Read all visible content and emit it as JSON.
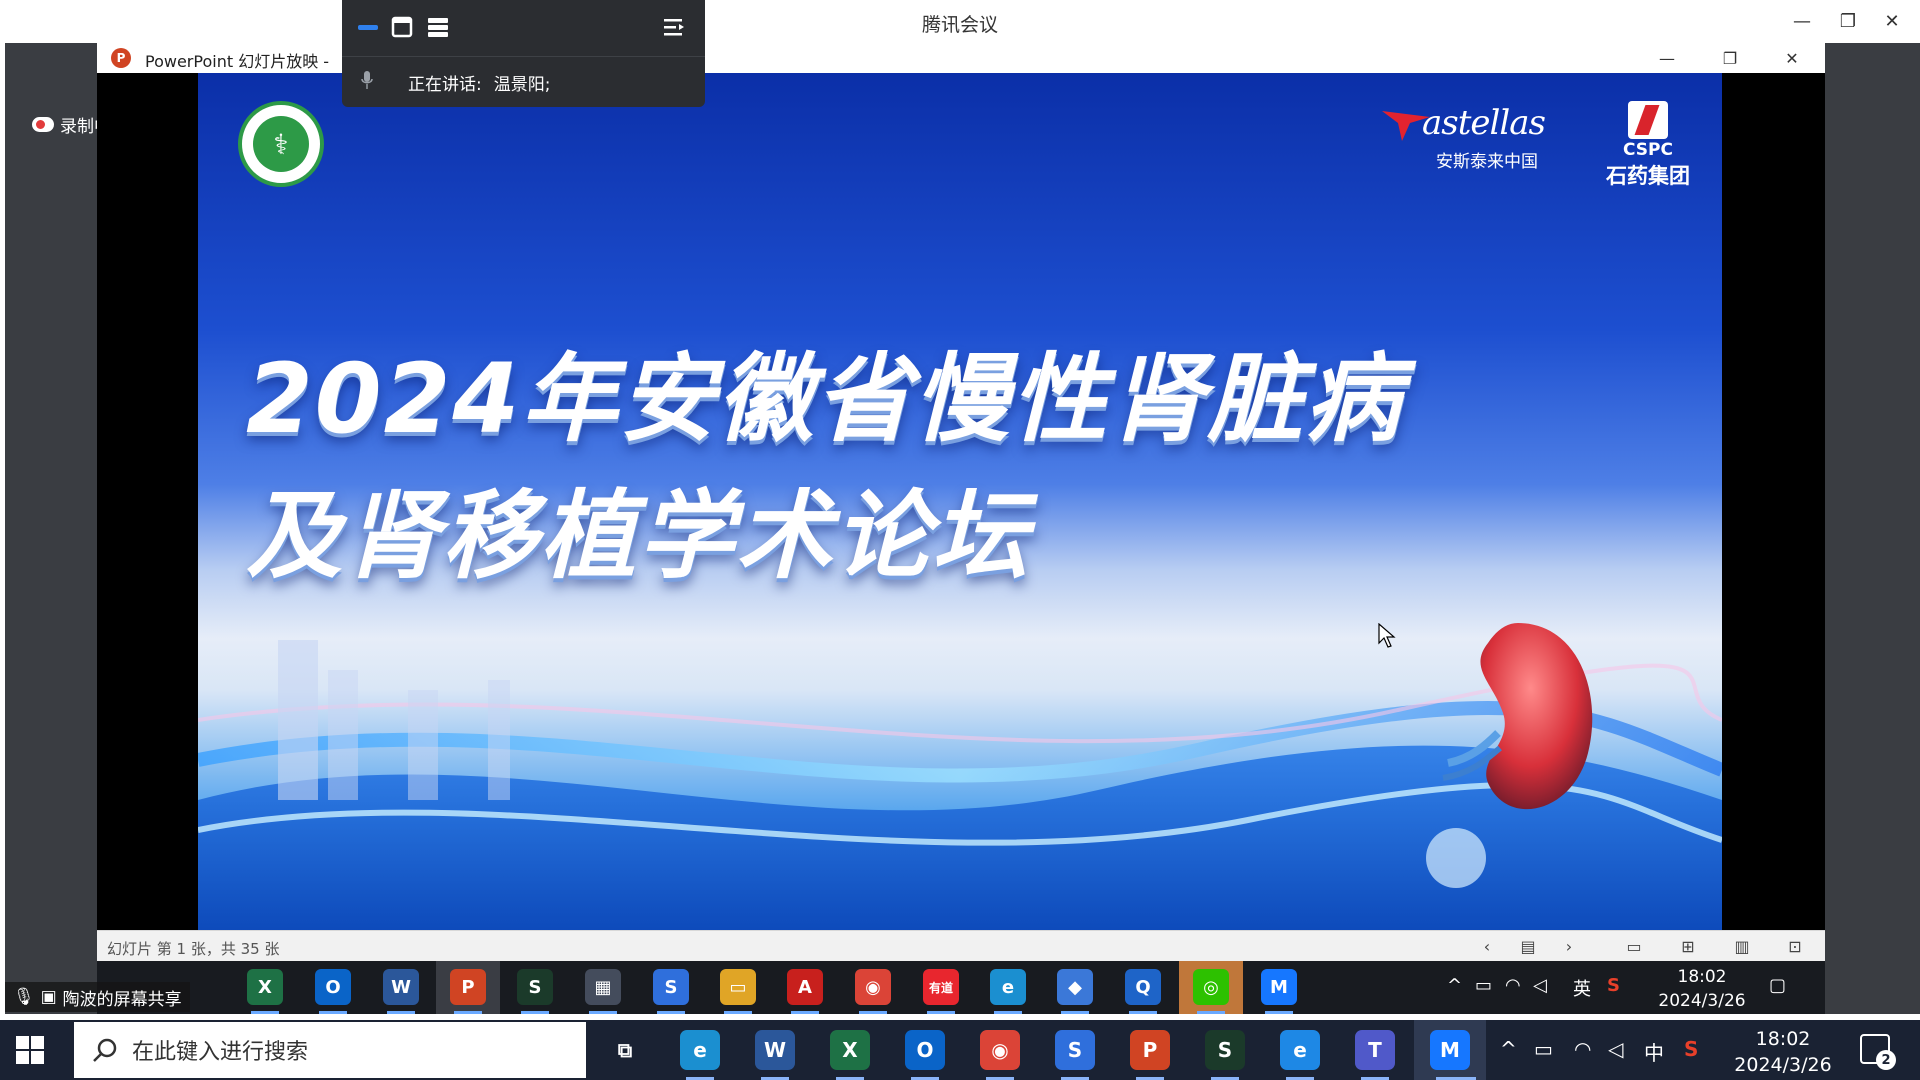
{
  "meeting_app": {
    "title": "腾讯会议",
    "recording_label": "录制中",
    "window_controls": {
      "minimize": "—",
      "restore": "❐",
      "close": "✕"
    }
  },
  "floating_toolbar": {
    "speaking_label": "正在讲话:",
    "speaker_name": "温景阳;"
  },
  "ppt_window": {
    "title": "PowerPoint 幻灯片放映 -",
    "controls": {
      "minimize": "—",
      "restore": "❐",
      "close": "✕"
    },
    "status_text": "幻灯片 第 1 张，共 35 张",
    "nav": {
      "prev": "‹",
      "next": "›"
    }
  },
  "slide": {
    "title_line1": "2024年安徽省慢性肾脏病",
    "title_line2": "及肾移植学术论坛",
    "sponsor1_name": "astellas",
    "sponsor1_cn": "安斯泰来中国",
    "sponsor2_name": "CSPC",
    "sponsor2_cn": "石药集团"
  },
  "screen_share": {
    "label": "陶波的屏幕共享"
  },
  "inner_taskbar": {
    "time": "18:02",
    "date": "2024/3/26",
    "ime": "英",
    "apps": [
      {
        "name": "excel-icon",
        "glyph": "X",
        "color": "#1e7145"
      },
      {
        "name": "outlook-icon",
        "glyph": "O",
        "color": "#0a64c8"
      },
      {
        "name": "word-icon",
        "glyph": "W",
        "color": "#2b579a"
      },
      {
        "name": "powerpoint-icon",
        "glyph": "P",
        "color": "#d04423"
      },
      {
        "name": "scribble-app-icon",
        "glyph": "S",
        "color": "#1b3a2a"
      },
      {
        "name": "calculator-icon",
        "glyph": "▦",
        "color": "#444c5c"
      },
      {
        "name": "sogou-icon",
        "glyph": "S",
        "color": "#2f6fdc"
      },
      {
        "name": "file-explorer-icon",
        "glyph": "▭",
        "color": "#e0a526"
      },
      {
        "name": "acrobat-icon",
        "glyph": "A",
        "color": "#c8201d"
      },
      {
        "name": "chrome-icon",
        "glyph": "◉",
        "color": "#db4437"
      },
      {
        "name": "youdao-icon",
        "glyph": "有道",
        "color": "#e8262e"
      },
      {
        "name": "edge-icon",
        "glyph": "e",
        "color": "#1b8fd0"
      },
      {
        "name": "teams-icon",
        "glyph": "◆",
        "color": "#3b78d8"
      },
      {
        "name": "search-app-icon",
        "glyph": "Q",
        "color": "#1e64c8"
      },
      {
        "name": "wechat-icon",
        "glyph": "◎",
        "color": "#2dc100"
      },
      {
        "name": "tencent-meeting-icon",
        "glyph": "M",
        "color": "#1677ff"
      }
    ]
  },
  "taskbar": {
    "search_placeholder": "在此键入进行搜索",
    "time": "18:02",
    "date": "2024/3/26",
    "ime": "中",
    "notification_count": "2",
    "apps": [
      {
        "name": "task-view-icon",
        "glyph": "⧉",
        "color": "transparent"
      },
      {
        "name": "edge-icon",
        "glyph": "e",
        "color": "#1b8fd0"
      },
      {
        "name": "word-icon",
        "glyph": "W",
        "color": "#2b579a"
      },
      {
        "name": "excel-icon",
        "glyph": "X",
        "color": "#1e7145"
      },
      {
        "name": "outlook-icon",
        "glyph": "O",
        "color": "#0a64c8"
      },
      {
        "name": "chrome-icon",
        "glyph": "◉",
        "color": "#db4437"
      },
      {
        "name": "sogou-icon",
        "glyph": "S",
        "color": "#2f6fdc"
      },
      {
        "name": "powerpoint-icon",
        "glyph": "P",
        "color": "#d04423"
      },
      {
        "name": "scribble-app-icon",
        "glyph": "S",
        "color": "#1b3a2a"
      },
      {
        "name": "ie-icon",
        "glyph": "e",
        "color": "#1e88e5"
      },
      {
        "name": "teams-icon",
        "glyph": "T",
        "color": "#5059c9"
      },
      {
        "name": "tencent-meeting-icon",
        "glyph": "M",
        "color": "#1677ff"
      }
    ]
  }
}
